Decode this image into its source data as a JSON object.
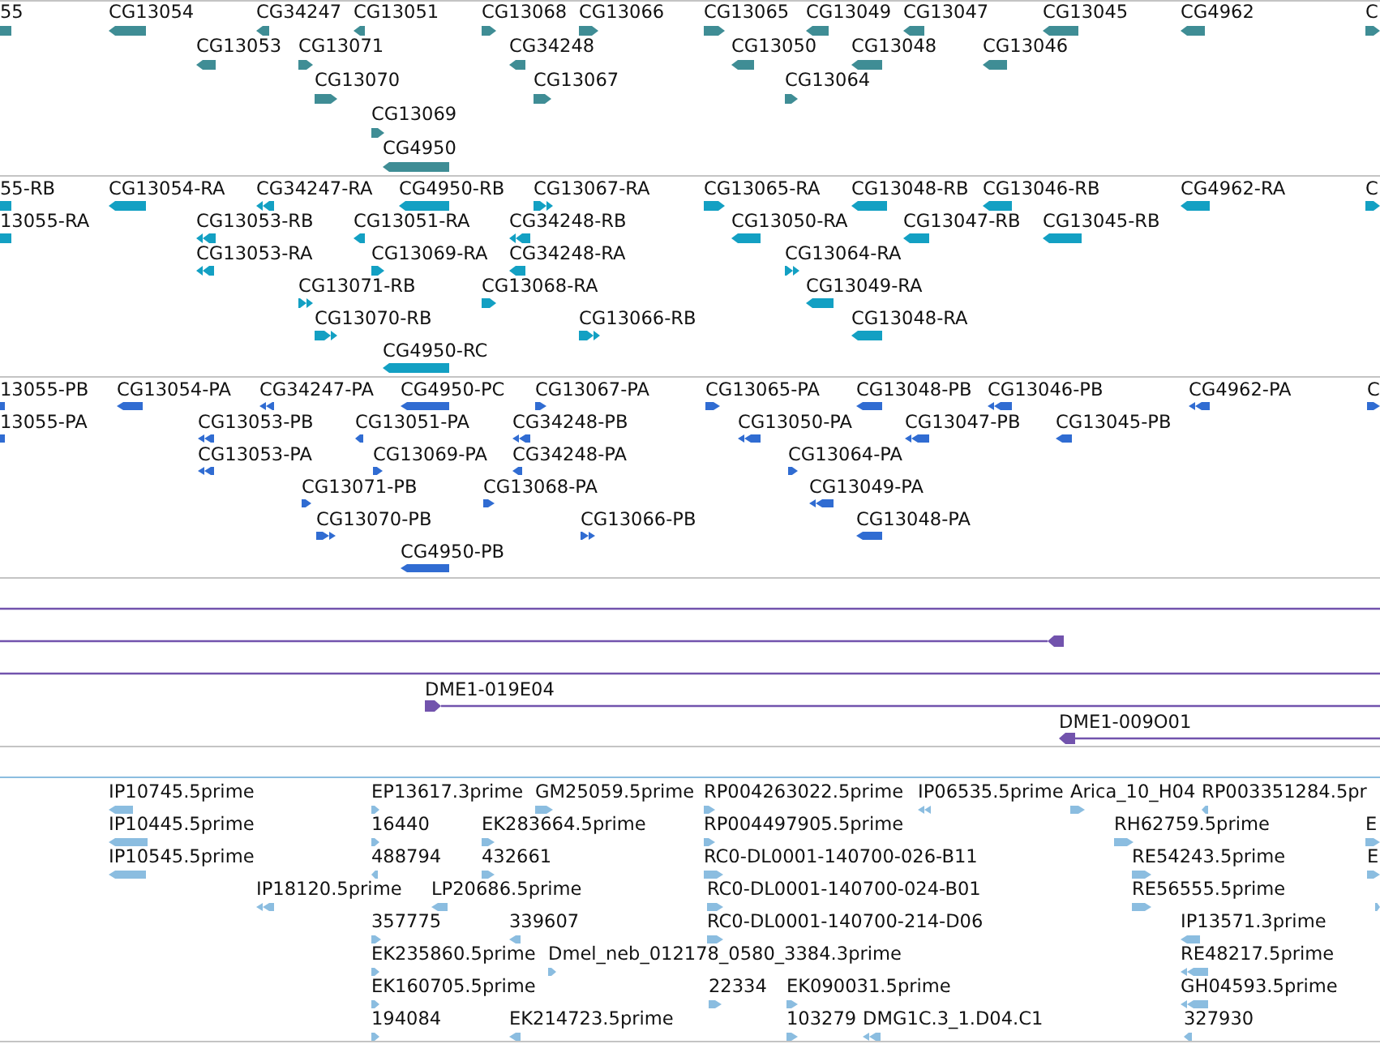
{
  "tracks": [
    {
      "kind": "gene",
      "rows": [
        {
          "features": [
            {
              "label": "55"
            },
            {
              "label": "CG13054",
              "reverse": true
            },
            {
              "label": "CG34247",
              "reverse": true
            },
            {
              "label": "CG13051",
              "reverse": true
            },
            {
              "label": "CG13068",
              "reverse": false
            },
            {
              "label": "CG13066",
              "reverse": false
            },
            {
              "label": "CG13065",
              "reverse": false
            },
            {
              "label": "CG13049",
              "reverse": true
            },
            {
              "label": "CG13047",
              "reverse": true
            },
            {
              "label": "CG13045",
              "reverse": true
            },
            {
              "label": "CG4962",
              "reverse": true
            },
            {
              "label": "C",
              "reverse": false
            }
          ]
        },
        {
          "features": [
            {
              "label": "CG13053",
              "reverse": true
            },
            {
              "label": "CG13071",
              "reverse": false
            },
            {
              "label": "CG34248",
              "reverse": true
            },
            {
              "label": "CG13050",
              "reverse": true
            },
            {
              "label": "CG13048",
              "reverse": true
            },
            {
              "label": "CG13046",
              "reverse": true
            }
          ]
        },
        {
          "features": [
            {
              "label": "CG13070",
              "reverse": false
            },
            {
              "label": "CG13067",
              "reverse": false
            },
            {
              "label": "CG13064",
              "reverse": false
            }
          ]
        },
        {
          "features": [
            {
              "label": "CG13069",
              "reverse": false
            }
          ]
        },
        {
          "features": [
            {
              "label": "CG4950",
              "reverse": true
            }
          ]
        }
      ]
    },
    {
      "kind": "transcript",
      "rows": [
        {
          "features": [
            {
              "label": "55-RB"
            },
            {
              "label": "CG13054-RA",
              "reverse": true
            },
            {
              "label": "CG34247-RA",
              "reverse": true
            },
            {
              "label": "CG4950-RB",
              "reverse": true
            },
            {
              "label": "CG13067-RA",
              "reverse": false
            },
            {
              "label": "CG13065-RA",
              "reverse": false
            },
            {
              "label": "CG13048-RB",
              "reverse": true
            },
            {
              "label": "CG13046-RB",
              "reverse": true
            },
            {
              "label": "CG4962-RA",
              "reverse": true
            },
            {
              "label": "C",
              "reverse": false
            }
          ]
        },
        {
          "features": [
            {
              "label": "13055-RA"
            },
            {
              "label": "CG13053-RB",
              "reverse": true
            },
            {
              "label": "CG13051-RA",
              "reverse": true
            },
            {
              "label": "CG34248-RB",
              "reverse": true
            },
            {
              "label": "CG13050-RA",
              "reverse": true
            },
            {
              "label": "CG13047-RB",
              "reverse": true
            },
            {
              "label": "CG13045-RB",
              "reverse": true
            }
          ]
        },
        {
          "features": [
            {
              "label": "CG13053-RA",
              "reverse": true
            },
            {
              "label": "CG13069-RA",
              "reverse": false
            },
            {
              "label": "CG34248-RA",
              "reverse": true
            },
            {
              "label": "CG13064-RA",
              "reverse": false
            }
          ]
        },
        {
          "features": [
            {
              "label": "CG13071-RB",
              "reverse": false
            },
            {
              "label": "CG13068-RA",
              "reverse": false
            },
            {
              "label": "CG13049-RA",
              "reverse": true
            }
          ]
        },
        {
          "features": [
            {
              "label": "CG13070-RB",
              "reverse": false
            },
            {
              "label": "CG13066-RB",
              "reverse": false
            },
            {
              "label": "CG13048-RA",
              "reverse": true
            }
          ]
        },
        {
          "features": [
            {
              "label": "CG4950-RC",
              "reverse": true
            }
          ]
        }
      ]
    },
    {
      "kind": "protein",
      "rows": [
        {
          "features": [
            {
              "label": "13055-PB"
            },
            {
              "label": "CG13054-PA",
              "reverse": true
            },
            {
              "label": "CG34247-PA",
              "reverse": true
            },
            {
              "label": "CG4950-PC",
              "reverse": true
            },
            {
              "label": "CG13067-PA",
              "reverse": false
            },
            {
              "label": "CG13065-PA",
              "reverse": false
            },
            {
              "label": "CG13048-PB",
              "reverse": true
            },
            {
              "label": "CG13046-PB",
              "reverse": true
            },
            {
              "label": "CG4962-PA",
              "reverse": true
            },
            {
              "label": "C",
              "reverse": false
            }
          ]
        },
        {
          "features": [
            {
              "label": "13055-PA"
            },
            {
              "label": "CG13053-PB",
              "reverse": true
            },
            {
              "label": "CG13051-PA",
              "reverse": true
            },
            {
              "label": "CG34248-PB",
              "reverse": true
            },
            {
              "label": "CG13050-PA",
              "reverse": true
            },
            {
              "label": "CG13047-PB",
              "reverse": true
            },
            {
              "label": "CG13045-PB",
              "reverse": true
            }
          ]
        },
        {
          "features": [
            {
              "label": "CG13053-PA",
              "reverse": true
            },
            {
              "label": "CG13069-PA",
              "reverse": false
            },
            {
              "label": "CG34248-PA",
              "reverse": true
            },
            {
              "label": "CG13064-PA",
              "reverse": false
            }
          ]
        },
        {
          "features": [
            {
              "label": "CG13071-PB",
              "reverse": false
            },
            {
              "label": "CG13068-PA",
              "reverse": false
            },
            {
              "label": "CG13049-PA",
              "reverse": true
            }
          ]
        },
        {
          "features": [
            {
              "label": "CG13070-PB",
              "reverse": false
            },
            {
              "label": "CG13066-PB",
              "reverse": false
            },
            {
              "label": "CG13048-PA",
              "reverse": true
            }
          ]
        },
        {
          "features": [
            {
              "label": "CG4950-PB",
              "reverse": true
            }
          ]
        }
      ]
    },
    {
      "kind": "clone",
      "rows": [
        {
          "features": [
            {
              "marker": false
            }
          ]
        },
        {
          "features": [
            {
              "marker": true,
              "reverse": true
            }
          ]
        },
        {
          "features": [
            {
              "marker": false
            }
          ]
        },
        {
          "features": [
            {
              "label": "DME1-019E04",
              "marker": true,
              "reverse": false
            }
          ]
        },
        {
          "features": [
            {
              "label": "DME1-009O01",
              "marker": true,
              "reverse": true
            }
          ]
        }
      ]
    },
    {
      "kind": "est",
      "rows": [
        {
          "features": [
            {
              "label": "IP10745.5prime",
              "reverse": true
            },
            {
              "label": "EP13617.3prime",
              "reverse": false
            },
            {
              "label": "GM25059.5prime",
              "reverse": false
            },
            {
              "label": "RP004263022.5prime",
              "reverse": false
            },
            {
              "label": "IP06535.5prime",
              "reverse": true
            },
            {
              "label": "Arica_10_H04",
              "reverse": false
            },
            {
              "label": "RP003351284.5pr",
              "reverse": true
            }
          ]
        },
        {
          "features": [
            {
              "label": "IP10445.5prime",
              "reverse": true
            },
            {
              "label": "16440",
              "reverse": false
            },
            {
              "label": "EK283664.5prime",
              "reverse": false
            },
            {
              "label": "RP004497905.5prime",
              "reverse": false
            },
            {
              "label": "RH62759.5prime",
              "reverse": false
            },
            {
              "label": "E",
              "reverse": false
            }
          ]
        },
        {
          "features": [
            {
              "label": "IP10545.5prime",
              "reverse": true
            },
            {
              "label": "488794",
              "reverse": true
            },
            {
              "label": "432661",
              "reverse": false
            },
            {
              "label": "RC0-DL0001-140700-026-B11",
              "reverse": false
            },
            {
              "label": "RE54243.5prime",
              "reverse": false
            },
            {
              "label": "E",
              "reverse": false
            }
          ]
        },
        {
          "features": [
            {
              "label": "IP18120.5prime",
              "reverse": true
            },
            {
              "label": "LP20686.5prime",
              "reverse": true
            },
            {
              "label": "RC0-DL0001-140700-024-B01",
              "reverse": false
            },
            {
              "label": "RE56555.5prime",
              "reverse": false
            },
            {
              "reverse": false
            }
          ]
        },
        {
          "features": [
            {
              "label": "357775",
              "reverse": false
            },
            {
              "label": "339607",
              "reverse": true
            },
            {
              "label": "RC0-DL0001-140700-214-D06",
              "reverse": false
            },
            {
              "label": "IP13571.3prime",
              "reverse": true
            }
          ]
        },
        {
          "features": [
            {
              "label": "EK235860.5prime",
              "reverse": false
            },
            {
              "label": "Dmel_neb_012178_0580_3384.3prime",
              "reverse": false
            },
            {
              "label": "RE48217.5prime",
              "reverse": true
            }
          ]
        },
        {
          "features": [
            {
              "label": "EK160705.5prime",
              "reverse": false
            },
            {
              "label": "22334",
              "reverse": false
            },
            {
              "label": "EK090031.5prime",
              "reverse": false
            },
            {
              "label": "GH04593.5prime",
              "reverse": true
            }
          ]
        },
        {
          "features": [
            {
              "label": "194084",
              "reverse": false
            },
            {
              "label": "EK214723.5prime",
              "reverse": true
            },
            {
              "label": "103279",
              "reverse": false
            },
            {
              "label": "DMG1C.3_1.D04.C1",
              "reverse": true
            },
            {
              "label": "327930",
              "reverse": true
            }
          ]
        }
      ]
    }
  ]
}
